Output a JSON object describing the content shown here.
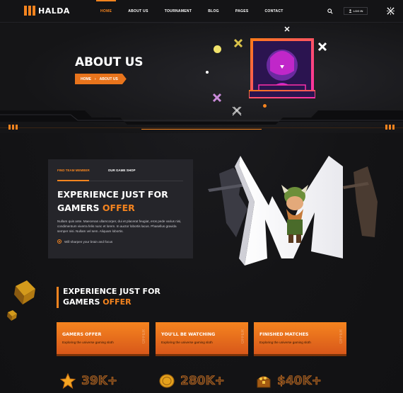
{
  "brand": {
    "name": "HALDA",
    "accent": "#f5841f"
  },
  "nav": {
    "items": [
      "HOME",
      "ABOUT US",
      "TOURNAMENT",
      "BLOG",
      "PAGES",
      "CONTACT"
    ],
    "active": "HOME"
  },
  "header": {
    "login_label": "LOG IN"
  },
  "hero": {
    "title": "ABOUT US",
    "breadcrumb": [
      "HOME",
      "ABOUT US"
    ]
  },
  "about_card": {
    "tabs": [
      "FIND TEAM MEMBER",
      "OUR GAME SHOP"
    ],
    "title": "EXPERIENCE JUST FOR GAMERS",
    "title_highlight": "OFFER",
    "body": "Nullam quis ante. Maecenas ullamcorper, dui et placerat feugiat, eros pede varius nisi, condimentum viverra felis nunc et lorem. In auctor lobortis lacus. Phasellus gravida semper nisi. Nullam vel sem. Aliquam lobortis.",
    "bullet": "Will sharpen your brain and focus"
  },
  "section2": {
    "title": "EXPERIENCE JUST FOR GAMERS",
    "title_highlight": "OFFER"
  },
  "features": [
    {
      "title": "GAMERS OFFER",
      "subtitle": "Exploring the universe gaming sloth",
      "ghost": "OFFER"
    },
    {
      "title": "YOU'LL BE WATCHING",
      "subtitle": "Exploring the universe gaming sloth",
      "ghost": "OFFER"
    },
    {
      "title": "FINISHED MATCHES",
      "subtitle": "Exploring the universe gaming sloth",
      "ghost": "OFFER"
    }
  ],
  "stats": [
    {
      "value": "39K+",
      "icon": "star-icon"
    },
    {
      "value": "280K+",
      "icon": "coin-icon"
    },
    {
      "value": "$40K+",
      "icon": "treasure-chest-icon"
    }
  ]
}
